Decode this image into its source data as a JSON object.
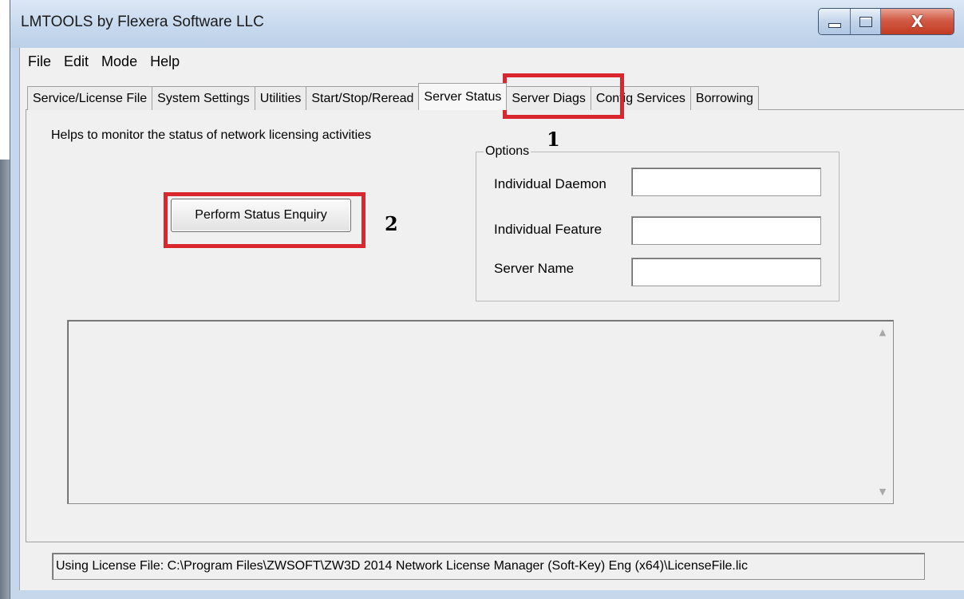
{
  "window": {
    "title": "LMTOOLS by Flexera Software LLC",
    "close_glyph": "X"
  },
  "menu": [
    "File",
    "Edit",
    "Mode",
    "Help"
  ],
  "tabs": [
    {
      "label": "Service/License File",
      "active": false
    },
    {
      "label": "System Settings",
      "active": false
    },
    {
      "label": "Utilities",
      "active": false
    },
    {
      "label": "Start/Stop/Reread",
      "active": false
    },
    {
      "label": "Server Status",
      "active": true
    },
    {
      "label": "Server Diags",
      "active": false
    },
    {
      "label": "Config Services",
      "active": false
    },
    {
      "label": "Borrowing",
      "active": false
    }
  ],
  "page": {
    "description": "Helps to monitor the status of network licensing activities",
    "perform_button": "Perform Status Enquiry",
    "options": {
      "legend": "Options",
      "daemon_label": "Individual Daemon",
      "daemon_value": "",
      "feature_label": "Individual Feature",
      "feature_value": "",
      "server_label": "Server Name",
      "server_value": ""
    },
    "output_text": ""
  },
  "annotations": {
    "step1": "1",
    "step2": "2",
    "color": "#d9262f"
  },
  "status": {
    "license_file": "Using License File:  C:\\Program Files\\ZWSOFT\\ZW3D 2014 Network License Manager (Soft-Key) Eng (x64)\\LicenseFile.lic"
  },
  "icons": {
    "minimize": "minimize-icon",
    "maximize": "maximize-icon",
    "close": "close-icon",
    "scroll_up": "scroll-up-arrow-icon",
    "scroll_down": "scroll-down-arrow-icon"
  }
}
